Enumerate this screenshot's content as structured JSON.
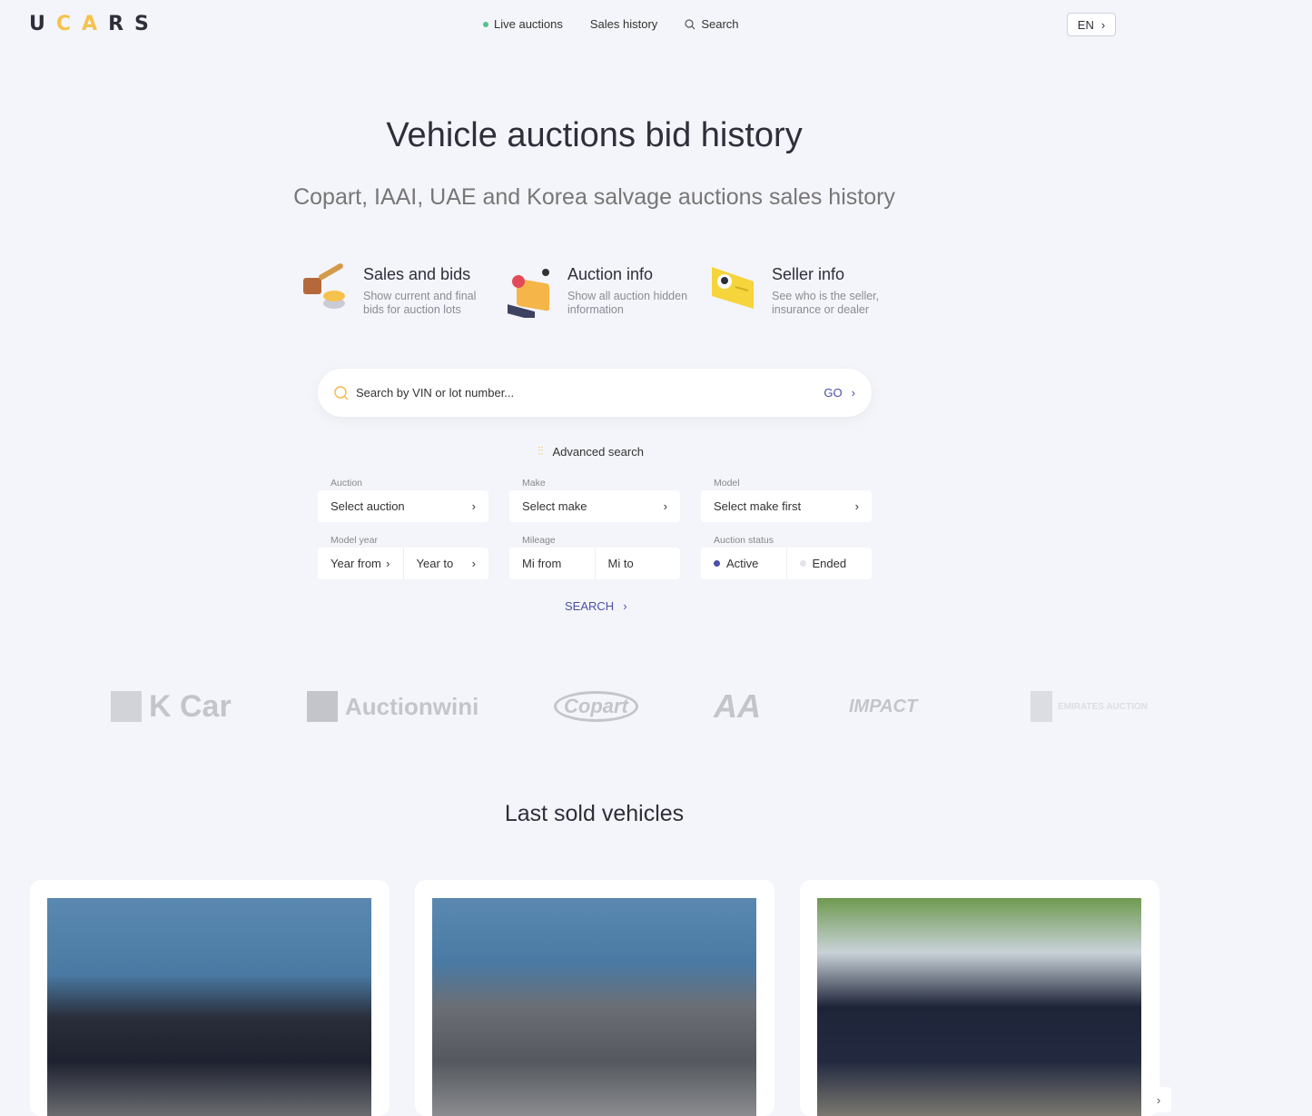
{
  "header": {
    "logo": [
      "U",
      "C",
      "A",
      "R",
      "S"
    ],
    "nav": [
      {
        "label": "Live auctions",
        "icon": "live-dot"
      },
      {
        "label": "Sales history"
      },
      {
        "label": "Search",
        "icon": "search-icon"
      }
    ],
    "lang": "EN"
  },
  "hero": {
    "title": "Vehicle auctions bid history",
    "subtitle": "Copart, IAAI, UAE and Korea salvage auctions sales history"
  },
  "features": [
    {
      "title": "Sales and bids",
      "desc": "Show current and final bids for auction lots",
      "icon": "gavel-coins-icon"
    },
    {
      "title": "Auction info",
      "desc": "Show all auction hidden information",
      "icon": "folder-laptop-icon"
    },
    {
      "title": "Seller info",
      "desc": "See who is the seller, insurance or dealer",
      "icon": "seller-card-icon"
    }
  ],
  "search": {
    "placeholder": "Search by VIN or lot number...",
    "go": "GO"
  },
  "advanced": {
    "label": "Advanced search",
    "auction": {
      "label": "Auction",
      "value": "Select auction"
    },
    "make": {
      "label": "Make",
      "value": "Select make"
    },
    "model": {
      "label": "Model",
      "value": "Select make first"
    },
    "year": {
      "label": "Model year",
      "from": "Year from",
      "to": "Year to"
    },
    "mileage": {
      "label": "Mileage",
      "from": "Mi from",
      "to": "Mi to"
    },
    "status": {
      "label": "Auction status",
      "active": "Active",
      "ended": "Ended",
      "selected": "Active"
    },
    "submit": "SEARCH"
  },
  "brands": [
    "K Car",
    "Auctionwini",
    "Copart",
    "AA",
    "IMPACT",
    "Emirates Auction"
  ],
  "last_sold": {
    "title": "Last sold vehicles"
  },
  "colors": {
    "accent": "#4a4fa8",
    "logo_yellow": "#f5c24c",
    "live": "#4fc38a"
  }
}
